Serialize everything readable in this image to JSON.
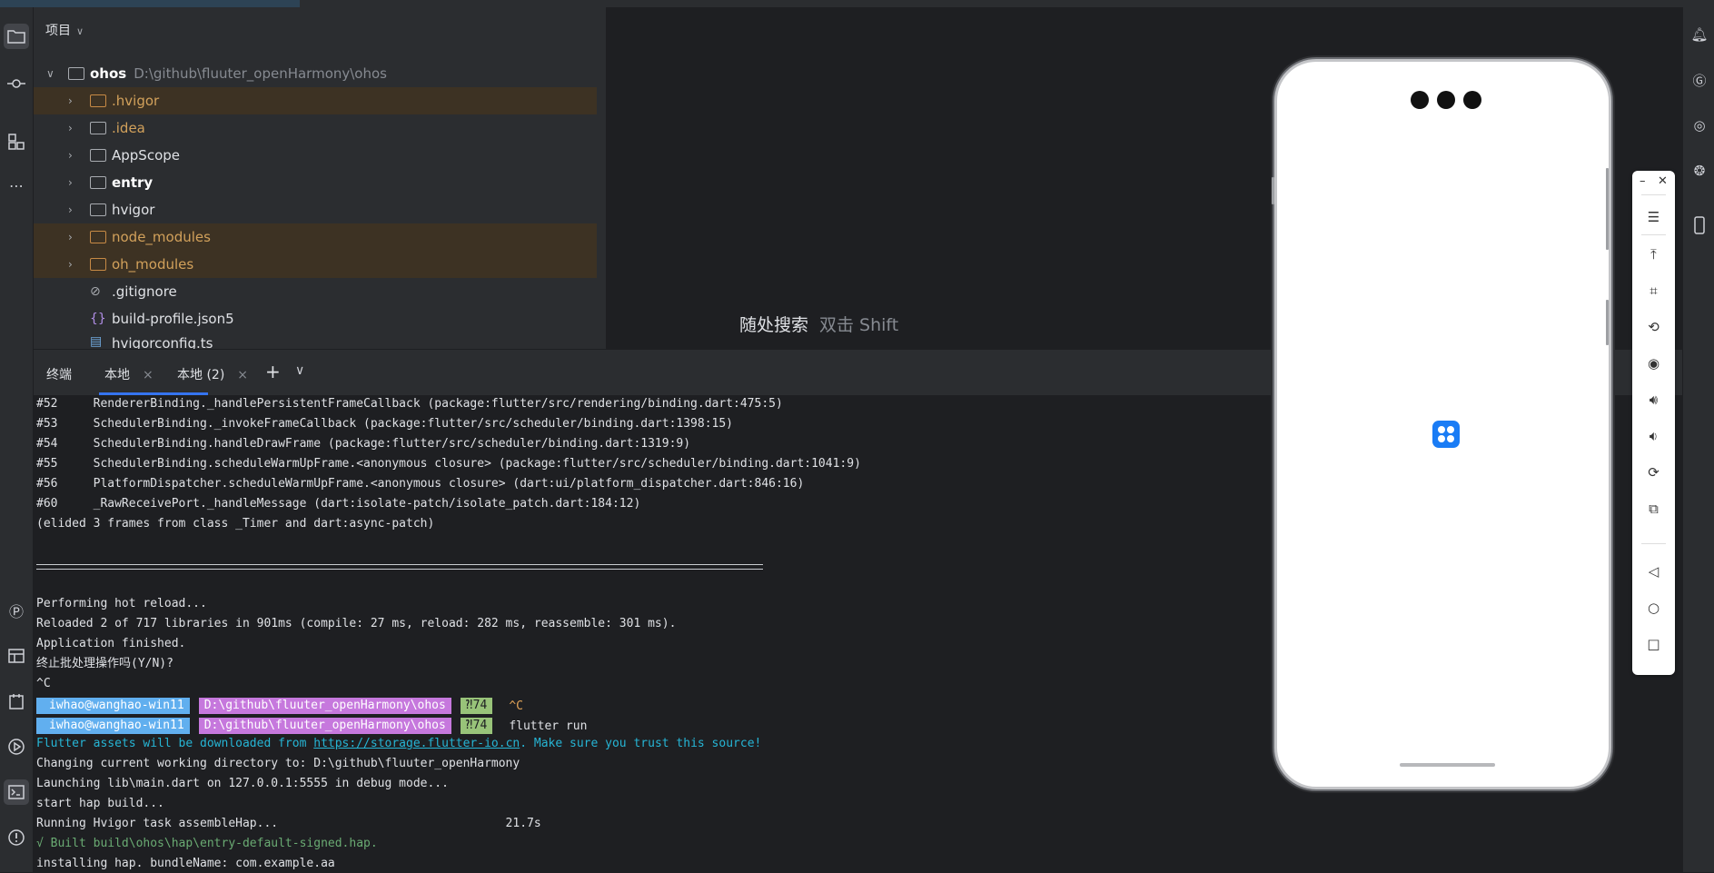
{
  "project_panel": {
    "title": "项目",
    "root": {
      "name": "ohos",
      "path": "D:\\github\\fluuter_openHarmony\\ohos"
    },
    "items": [
      {
        "name": ".hvigor",
        "type": "folder",
        "style": "excluded"
      },
      {
        "name": ".idea",
        "type": "folder",
        "style": "excluded"
      },
      {
        "name": "AppScope",
        "type": "folder",
        "style": "normal"
      },
      {
        "name": "entry",
        "type": "module",
        "style": "bold"
      },
      {
        "name": "hvigor",
        "type": "folder",
        "style": "normal"
      },
      {
        "name": "node_modules",
        "type": "folder",
        "style": "excluded"
      },
      {
        "name": "oh_modules",
        "type": "folder",
        "style": "excluded"
      },
      {
        "name": ".gitignore",
        "type": "file-ignore",
        "style": "normal"
      },
      {
        "name": "build-profile.json5",
        "type": "file-json",
        "style": "normal"
      },
      {
        "name": "hvigorconfig.ts",
        "type": "file-ts",
        "style": "normal"
      }
    ]
  },
  "editor": {
    "search_hint": "随处搜索",
    "search_key": "双击 Shift"
  },
  "terminal": {
    "title": "终端",
    "tabs": [
      {
        "label": "本地"
      },
      {
        "label": "本地 (2)"
      }
    ],
    "add_label": "+",
    "stack_lines": [
      "#52     RendererBinding._handlePersistentFrameCallback (package:flutter/src/rendering/binding.dart:475:5)",
      "#53     SchedulerBinding._invokeFrameCallback (package:flutter/src/scheduler/binding.dart:1398:15)",
      "#54     SchedulerBinding.handleDrawFrame (package:flutter/src/scheduler/binding.dart:1319:9)",
      "#55     SchedulerBinding.scheduleWarmUpFrame.<anonymous closure> (package:flutter/src/scheduler/binding.dart:1041:9)",
      "#56     PlatformDispatcher.scheduleWarmUpFrame.<anonymous closure> (dart:ui/platform_dispatcher.dart:846:16)",
      "#60     _RawReceivePort._handleMessage (dart:isolate-patch/isolate_patch.dart:184:12)",
      "(elided 3 frames from class _Timer and dart:async-patch)"
    ],
    "reload_lines": [
      "Performing hot reload...",
      "Reloaded 2 of 717 libraries in 901ms (compile: 27 ms, reload: 282 ms, reassemble: 301 ms).",
      "Application finished.",
      "终止批处理操作吗(Y/N)?",
      "^C"
    ],
    "prompt": {
      "user": "iwhao@wanghao-win11",
      "dir": "D:\\github\\fluuter_openHarmony\\ohos",
      "git": "⁈74"
    },
    "prompt_cmd_1": "^C",
    "prompt_cmd_2": "flutter run",
    "notice_prefix": "Flutter assets will be downloaded from ",
    "notice_link": "https://storage.flutter-io.cn",
    "notice_suffix": ". Make sure you trust this source!",
    "run_lines": [
      "Changing current working directory to: D:\\github\\fluuter_openHarmony",
      "Launching lib\\main.dart on 127.0.0.1:5555 in debug mode...",
      "start hap build...",
      "Running Hvigor task assembleHap...                                21.7s"
    ],
    "built_line": "√ Built build\\ohos\\hap\\entry-default-signed.hap.",
    "last_line": "installing hap. bundleName: com.example.aa"
  },
  "emulator_toolbar": {
    "minimize": "–",
    "close": "✕",
    "buttons": [
      "menu-icon",
      "rotate-top-icon",
      "crop-icon",
      "rotate-icon",
      "screenshot-icon",
      "volume-up-icon",
      "volume-down-icon",
      "shake-icon",
      "multi-screen-icon",
      "back-icon",
      "home-icon",
      "recent-icon"
    ]
  }
}
